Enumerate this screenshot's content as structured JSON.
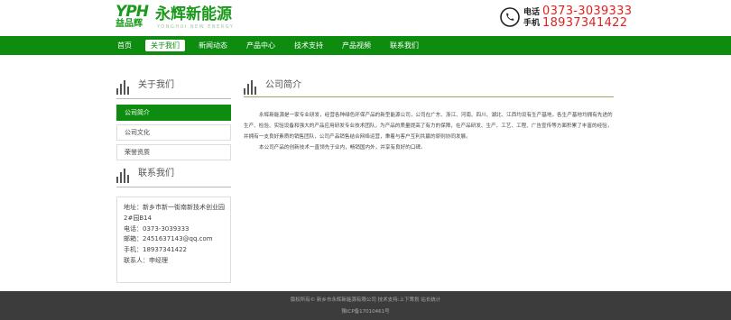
{
  "header": {
    "logo_mark": "YPH",
    "logo_mark_sub": "益品辉",
    "logo_cn": "永辉新能源",
    "logo_en": "YONGHUI NEW ENERGY",
    "phone_icon": "phone-icon",
    "tel_label": "电话",
    "mobile_label": "手机",
    "tel": "0373-3039333",
    "mobile": "18937341422"
  },
  "nav": {
    "items": [
      {
        "label": "首页"
      },
      {
        "label": "关于我们"
      },
      {
        "label": "新闻动态"
      },
      {
        "label": "产品中心"
      },
      {
        "label": "技术支持"
      },
      {
        "label": "产品视频"
      },
      {
        "label": "联系我们"
      }
    ],
    "active_index": 1
  },
  "sidebar": {
    "about_title": "关于我们",
    "menu": [
      {
        "label": "公司简介"
      },
      {
        "label": "公司文化"
      },
      {
        "label": "荣誉资质"
      }
    ],
    "contact_title": "联系我们",
    "contact_lines": [
      "地址：新乡市新一街南新技术创业园",
      "2#园B14",
      "电话：0373-3039333",
      "邮箱：2451637143@qq.com",
      "手机：18937341422",
      "联系人：申经理"
    ]
  },
  "main": {
    "title": "公司简介",
    "paragraphs": [
      "永辉新能源是一家专业研发，经营各种绿色环保产品的新型能源公司，公司在广东、浙江、河南、四川、湖北、江西均设有生产基地，各生产基地均拥有先进的生产、检验、实验设备和强大的产品应用研发专业技术团队，为产品的质量提高了有力的保障，在产品研发、生产、工艺、工程、广告宣传等方面积累了丰富的经验，并拥有一支良好素质的销售团队，公司产品销售结合网络运营，秉着与客户互利共赢的原则协同发展。",
      "本公司产品的创新技术一直领先于业内，畅销国内外，并享有良好的口碑。"
    ]
  },
  "footer": {
    "line1": "版权所有© 新乡市永辉新能源有限公司 技术支持:上下策划 站长统计",
    "line2": "豫ICP备17010461号"
  },
  "colors": {
    "brand_green": "#0d8c10",
    "accent_red": "#e02020",
    "footer_bg": "#3c3c3c"
  }
}
